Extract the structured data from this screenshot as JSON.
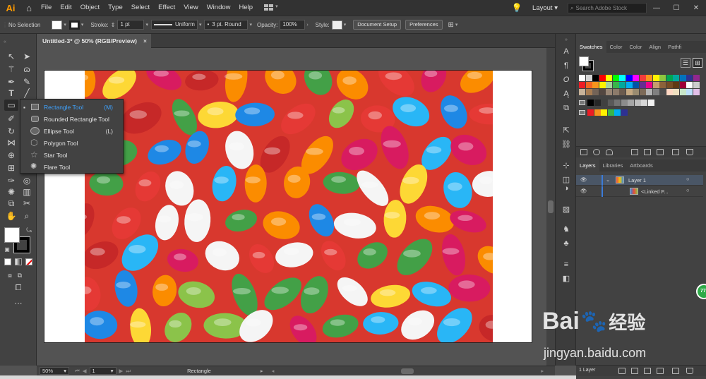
{
  "app": {
    "logo": "Ai",
    "menus": [
      "File",
      "Edit",
      "Object",
      "Type",
      "Select",
      "Effect",
      "View",
      "Window",
      "Help"
    ],
    "workspace": "Layout",
    "search_placeholder": "Search Adobe Stock"
  },
  "control_bar": {
    "selection": "No Selection",
    "stroke_label": "Stroke:",
    "stroke_weight": "1 pt",
    "profile": "Uniform",
    "brush": "3 pt. Round",
    "opacity_label": "Opacity:",
    "opacity": "100%",
    "style_label": "Style:",
    "document_setup": "Document Setup",
    "preferences": "Preferences"
  },
  "document": {
    "tab_title": "Untitled-3* @ 50% (RGB/Preview)",
    "close_glyph": "×"
  },
  "flyout": {
    "items": [
      {
        "label": "Rectangle Tool",
        "key": "(M)",
        "icon": "rectangle-icon",
        "selected": true
      },
      {
        "label": "Rounded Rectangle Tool",
        "key": "",
        "icon": "rounded-rectangle-icon",
        "selected": false
      },
      {
        "label": "Ellipse Tool",
        "key": "(L)",
        "icon": "ellipse-icon",
        "selected": false
      },
      {
        "label": "Polygon Tool",
        "key": "",
        "icon": "polygon-icon",
        "selected": false
      },
      {
        "label": "Star Tool",
        "key": "",
        "icon": "star-icon",
        "selected": false
      },
      {
        "label": "Flare Tool",
        "key": "",
        "icon": "flare-icon",
        "selected": false
      }
    ]
  },
  "status_bar": {
    "zoom": "50%",
    "artboard_number": "1",
    "current_tool": "Rectangle"
  },
  "swatches_panel": {
    "tabs": [
      "Swatches",
      "Color",
      "Color",
      "Align",
      "Pathfi"
    ],
    "row1": [
      "#ffffff",
      "#d4d4d4",
      "#000000",
      "#ff0000",
      "#ffff00",
      "#00ff00",
      "#00ffff",
      "#0000ff",
      "#ff00ff",
      "#f23c3c",
      "#f7941d",
      "#fff200",
      "#8dc63f",
      "#00a651",
      "#00a99d",
      "#0072bc",
      "#2e3192",
      "#92278f"
    ],
    "row2": [
      "#ed1c24",
      "#f26522",
      "#f7941d",
      "#fff200",
      "#a3d39c",
      "#39b54a",
      "#00a99d",
      "#00aeef",
      "#0054a6",
      "#662d91",
      "#ec008c",
      "#c69c6d",
      "#8c6239",
      "#754c24",
      "#603913",
      "#9e0039",
      "#ffffff",
      "#cccccc"
    ],
    "row3": [
      "#c7b299",
      "#a67c52",
      "#736357",
      "#534741",
      "#998675",
      "#8c7b6b",
      "#6b5b4e",
      "#c4a882",
      "#998b70",
      "#7c6a58",
      "#b3b3b3",
      "#808080",
      "#4d4d4d",
      "#ffd8c4",
      "#f0e0c0",
      "#c8e6c9",
      "#bbdefb",
      "#e1bee7"
    ],
    "row4": [
      "#000000",
      "#262626",
      "#404040",
      "#595959",
      "#737373",
      "#8c8c8c",
      "#a6a6a6",
      "#bfbfbf",
      "#d9d9d9",
      "#f2f2f2"
    ],
    "row5": [
      "#ed1c24",
      "#f7941d",
      "#fff200",
      "#39b54a",
      "#00aeef",
      "#2e3192"
    ]
  },
  "layers_panel": {
    "tabs": [
      "Layers",
      "Libraries",
      "Artboards"
    ],
    "layer_name": "Layer 1",
    "sublayer_name": "<Linked F...",
    "count": "1 Layer"
  },
  "watermark": {
    "brand": "Bai",
    "brand2": "经验",
    "url": "jingyan.baidu.com"
  },
  "badge": "77"
}
